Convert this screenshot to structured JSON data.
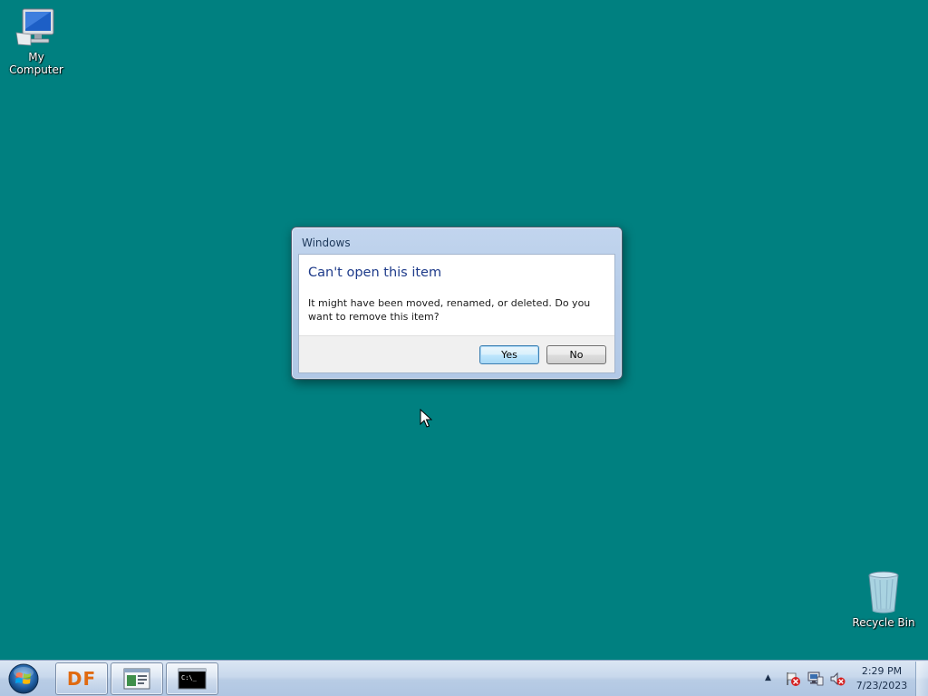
{
  "desktop": {
    "background_color": "#008080",
    "icons": [
      {
        "label": "My Computer",
        "icon": "computer-icon"
      },
      {
        "label": "Recycle Bin",
        "icon": "recycle-bin-icon"
      }
    ]
  },
  "dialog": {
    "title": "Windows",
    "heading": "Can't open this item",
    "message": "It might have been moved, renamed, or deleted. Do you want to remove this item?",
    "yes_label": "Yes",
    "no_label": "No",
    "default_button": "Yes"
  },
  "taskbar": {
    "start_icon": "windows-start-orb-icon",
    "buttons": [
      {
        "label": "DF",
        "icon": "df-icon"
      },
      {
        "label": "",
        "icon": "explorer-window-icon"
      },
      {
        "label": "C:\\_",
        "icon": "command-prompt-icon"
      }
    ],
    "tray": {
      "icons": [
        "show-hidden-icons-icon",
        "action-center-flag-icon",
        "network-icon",
        "volume-muted-icon"
      ],
      "time": "2:29 PM",
      "date": "7/23/2023"
    }
  }
}
